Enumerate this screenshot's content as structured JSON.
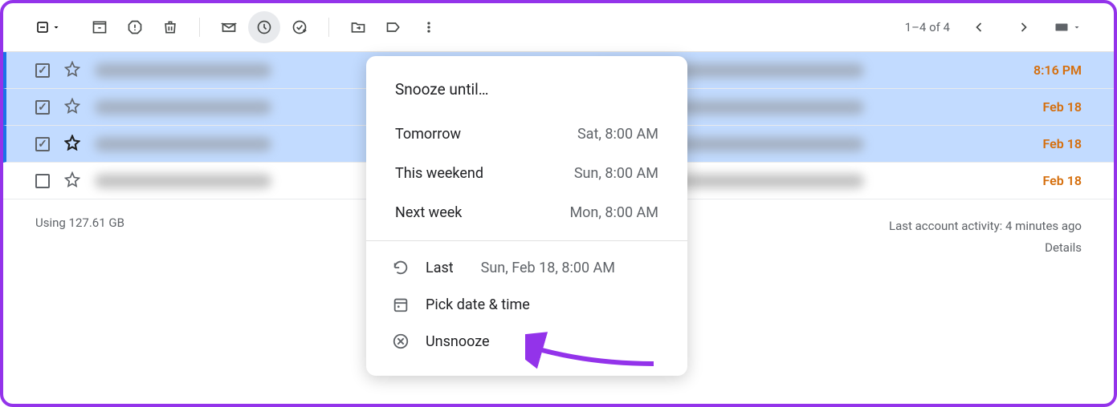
{
  "pagination": {
    "range": "1–4 of 4"
  },
  "rows": [
    {
      "selected": true,
      "starred": false,
      "time": "8:16 PM"
    },
    {
      "selected": true,
      "starred": false,
      "time": "Feb 18"
    },
    {
      "selected": true,
      "starred": true,
      "time": "Feb 18"
    },
    {
      "selected": false,
      "starred": false,
      "time": "Feb 18"
    }
  ],
  "snooze": {
    "title": "Snooze until…",
    "options": [
      {
        "label": "Tomorrow",
        "time": "Sat, 8:00 AM"
      },
      {
        "label": "This weekend",
        "time": "Sun, 8:00 AM"
      },
      {
        "label": "Next week",
        "time": "Mon, 8:00 AM"
      }
    ],
    "last": {
      "label": "Last",
      "time": "Sun, Feb 18, 8:00 AM"
    },
    "pick": "Pick date & time",
    "unsnooze": "Unsnooze"
  },
  "footer": {
    "storage": "Using 127.61 GB",
    "activity": "Last account activity: 4 minutes ago",
    "details": "Details"
  }
}
